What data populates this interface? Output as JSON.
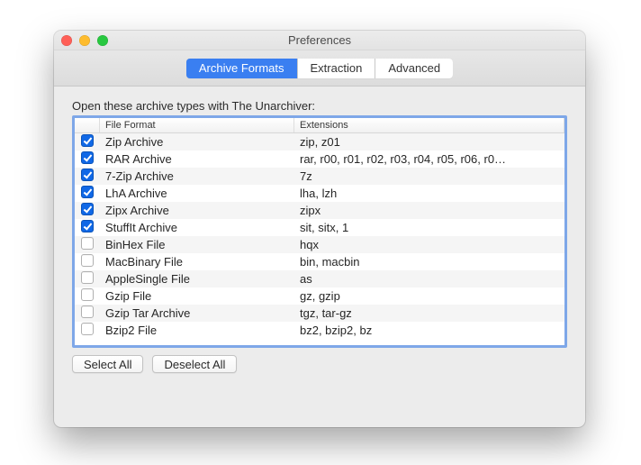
{
  "window": {
    "title": "Preferences"
  },
  "tabs": {
    "archive_formats": "Archive Formats",
    "extraction": "Extraction",
    "advanced": "Advanced"
  },
  "instruction": "Open these archive types with The Unarchiver:",
  "columns": {
    "format": "File Format",
    "extensions": "Extensions"
  },
  "rows": [
    {
      "checked": true,
      "format": "Zip Archive",
      "ext": "zip, z01"
    },
    {
      "checked": true,
      "format": "RAR Archive",
      "ext": "rar, r00, r01, r02, r03, r04, r05, r06, r0…"
    },
    {
      "checked": true,
      "format": "7-Zip Archive",
      "ext": "7z"
    },
    {
      "checked": true,
      "format": "LhA Archive",
      "ext": "lha, lzh"
    },
    {
      "checked": true,
      "format": "Zipx Archive",
      "ext": "zipx"
    },
    {
      "checked": true,
      "format": "StuffIt Archive",
      "ext": "sit, sitx, 1"
    },
    {
      "checked": false,
      "format": "BinHex File",
      "ext": "hqx"
    },
    {
      "checked": false,
      "format": "MacBinary File",
      "ext": "bin, macbin"
    },
    {
      "checked": false,
      "format": "AppleSingle File",
      "ext": "as"
    },
    {
      "checked": false,
      "format": "Gzip File",
      "ext": "gz, gzip"
    },
    {
      "checked": false,
      "format": "Gzip Tar Archive",
      "ext": "tgz, tar-gz"
    },
    {
      "checked": false,
      "format": "Bzip2 File",
      "ext": "bz2, bzip2, bz"
    }
  ],
  "buttons": {
    "select_all": "Select All",
    "deselect_all": "Deselect All"
  }
}
